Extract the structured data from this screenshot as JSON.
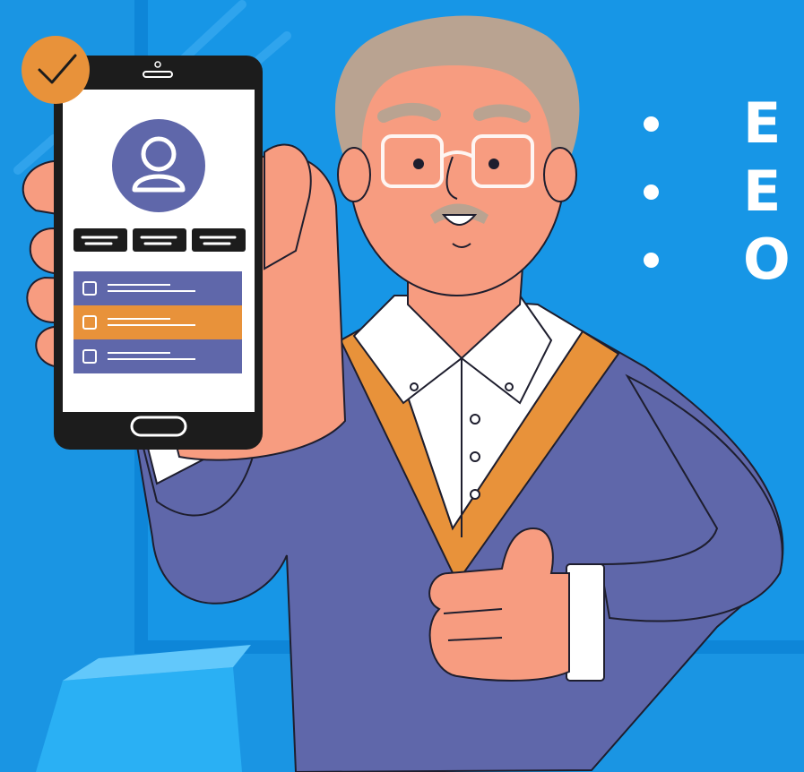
{
  "bullets": [
    {
      "text": "E"
    },
    {
      "text": "E"
    },
    {
      "text": "O"
    }
  ],
  "phone": {
    "checkmark_badge": "check-badge",
    "rows": [
      {
        "color": "#5f67aa"
      },
      {
        "color": "#e8923a"
      },
      {
        "color": "#5f67aa"
      }
    ]
  },
  "colors": {
    "background": "#1a95e3",
    "sweater": "#5f67aa",
    "accent_orange": "#e8923a",
    "skin": "#f79c80",
    "hair": "#b9a391"
  }
}
